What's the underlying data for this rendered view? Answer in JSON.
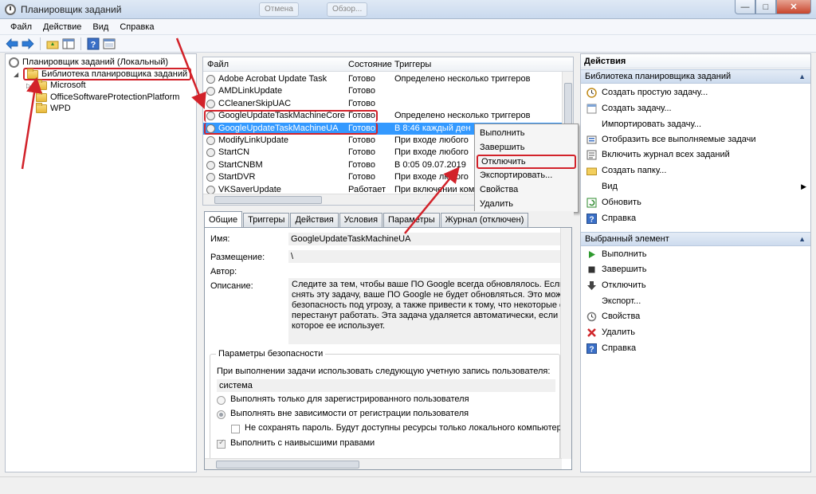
{
  "window": {
    "title": "Планировщик заданий",
    "ghost_tabs": [
      "Отмена",
      "Обзор..."
    ],
    "controls": {
      "minimize": "—",
      "maximize": "□",
      "close": "✕"
    }
  },
  "menu": [
    "Файл",
    "Действие",
    "Вид",
    "Справка"
  ],
  "toolbar_icons": [
    "back-arrow-icon",
    "forward-arrow-icon",
    "folder-up-icon",
    "console-tree-icon",
    "help-icon",
    "properties-icon"
  ],
  "tree": {
    "root": "Планировщик заданий (Локальный)",
    "library": "Библиотека планировщика заданий",
    "children": [
      "Microsoft",
      "OfficeSoftwareProtectionPlatform",
      "WPD"
    ]
  },
  "tasklist": {
    "columns": [
      "Файл",
      "Состояние",
      "Триггеры"
    ],
    "rows": [
      {
        "name": "Adobe Acrobat Update Task",
        "state": "Готово",
        "trigger": "Определено несколько триггеров"
      },
      {
        "name": "AMDLinkUpdate",
        "state": "Готово",
        "trigger": ""
      },
      {
        "name": "CCleanerSkipUAC",
        "state": "Готово",
        "trigger": ""
      },
      {
        "name": "GoogleUpdateTaskMachineCore",
        "state": "Готово",
        "trigger": "Определено несколько триггеров"
      },
      {
        "name": "GoogleUpdateTaskMachineUA",
        "state": "Готово",
        "trigger": "В 8:46 каждый ден"
      },
      {
        "name": "ModifyLinkUpdate",
        "state": "Готово",
        "trigger": "При входе любого"
      },
      {
        "name": "StartCN",
        "state": "Готово",
        "trigger": "При входе любого"
      },
      {
        "name": "StartCNBM",
        "state": "Готово",
        "trigger": "В 0:05 09.07.2019"
      },
      {
        "name": "StartDVR",
        "state": "Готово",
        "trigger": "При входе любого"
      },
      {
        "name": "VKSaverUpdate",
        "state": "Работает",
        "trigger": "При включении ком"
      }
    ]
  },
  "context_menu": [
    "Выполнить",
    "Завершить",
    "Отключить",
    "Экспортировать...",
    "Свойства",
    "Удалить"
  ],
  "detail": {
    "tabs": [
      "Общие",
      "Триггеры",
      "Действия",
      "Условия",
      "Параметры",
      "Журнал (отключен)"
    ],
    "name_label": "Имя:",
    "name_value": "GoogleUpdateTaskMachineUA",
    "location_label": "Размещение:",
    "location_value": "\\",
    "author_label": "Автор:",
    "description_label": "Описание:",
    "description_lines": [
      "Следите за тем, чтобы ваше ПО Google всегда обновлялось. Если отключи",
      "снять эту задачу, ваше ПО Google не будет обновляться. Это может постав",
      "безопасность под угрозу, а также привести к тому, что некоторые функци",
      "перестанут работать. Эта задача удаляется автоматически, если нет ПО Goog",
      "которое ее использует."
    ],
    "security_legend": "Параметры безопасности",
    "account_prompt": "При выполнении задачи использовать следующую учетную запись пользователя:",
    "account_value": "система",
    "radio_only_registered": "Выполнять только для зарегистрированного пользователя",
    "radio_regardless": "Выполнять вне зависимости от регистрации пользователя",
    "check_no_password": "Не сохранять пароль. Будут доступны ресурсы только локального компьютера.",
    "check_highest": "Выполнить с наивысшими правами"
  },
  "actions_panel": {
    "title": "Действия",
    "library_section": "Библиотека планировщика заданий",
    "library_items": [
      "Создать простую задачу...",
      "Создать задачу...",
      "Импортировать задачу...",
      "Отобразить все выполняемые задачи",
      "Включить журнал всех заданий",
      "Создать папку...",
      "Вид",
      "Обновить",
      "Справка"
    ],
    "selected_section": "Выбранный элемент",
    "selected_items": [
      "Выполнить",
      "Завершить",
      "Отключить",
      "Экспорт...",
      "Свойства",
      "Удалить",
      "Справка"
    ]
  },
  "colors": {
    "selection": "#3399ff",
    "annotation_red": "#d2222a"
  }
}
